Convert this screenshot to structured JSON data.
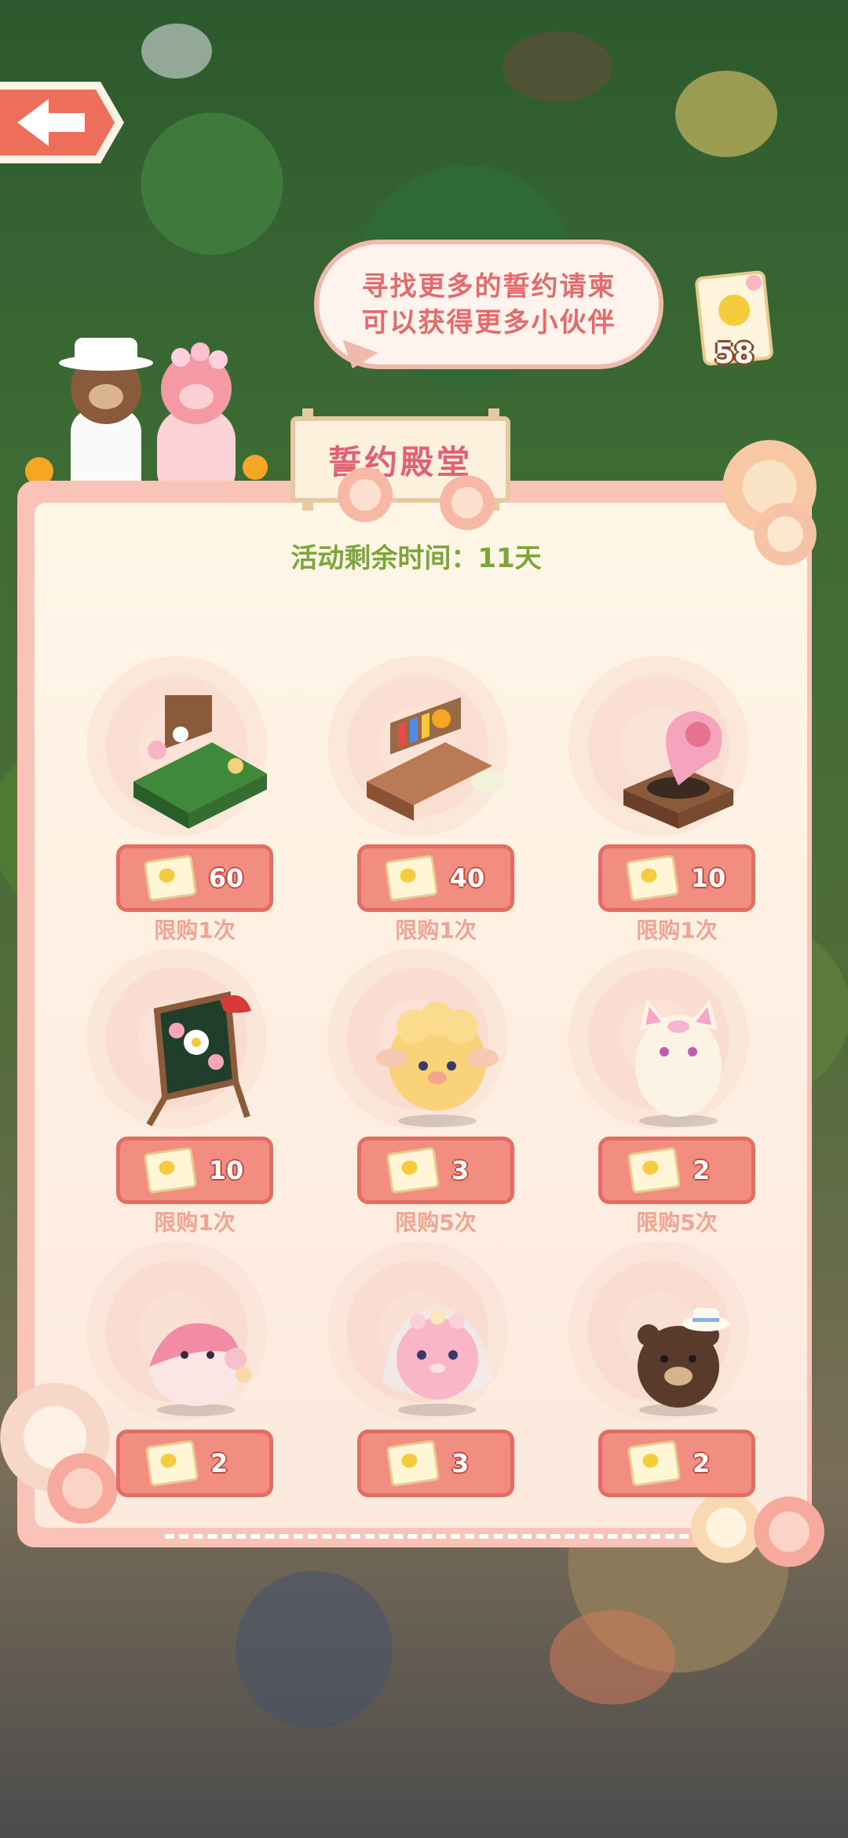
{
  "bubble": {
    "line1": "寻找更多的誓约请柬",
    "line2": "可以获得更多小伙伴"
  },
  "ticket_count": "58",
  "title": "誓约殿堂",
  "timer": "活动剩余时间：11天",
  "items": [
    {
      "price": "60",
      "limit": "限购1次",
      "icon": "garden-bed-icon"
    },
    {
      "price": "40",
      "limit": "限购1次",
      "icon": "bookshelf-desk-icon"
    },
    {
      "price": "10",
      "limit": "限购1次",
      "icon": "gramophone-icon"
    },
    {
      "price": "10",
      "limit": "限购1次",
      "icon": "flower-board-icon"
    },
    {
      "price": "3",
      "limit": "限购5次",
      "icon": "sheep-pet-icon"
    },
    {
      "price": "2",
      "limit": "限购5次",
      "icon": "cat-pet-icon"
    },
    {
      "price": "2",
      "limit": "",
      "icon": "pink-bird-pet-icon"
    },
    {
      "price": "3",
      "limit": "",
      "icon": "bride-pet-icon"
    },
    {
      "price": "2",
      "limit": "",
      "icon": "bear-pet-icon"
    }
  ]
}
